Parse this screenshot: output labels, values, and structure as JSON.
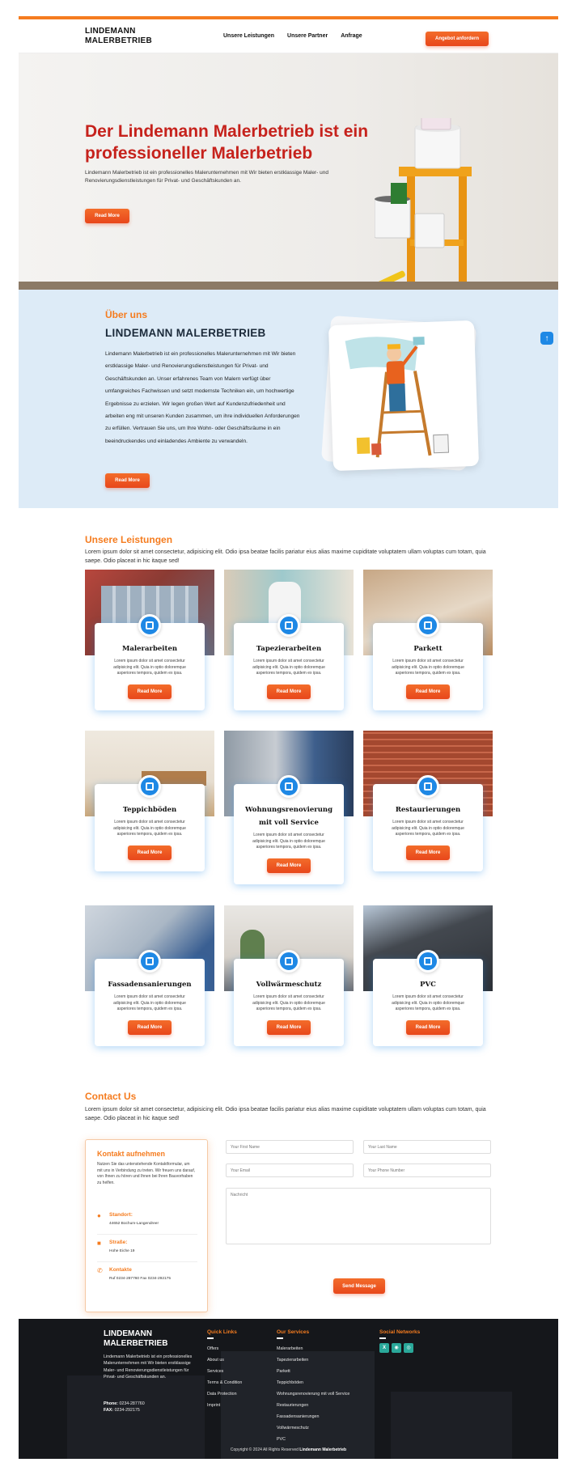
{
  "brand": {
    "logo_line1": "LINDEMANN",
    "logo_line2": "MALERBETRIEB"
  },
  "nav": {
    "links": [
      "Unsere Leistungen",
      "Unsere Partner",
      "Anfrage"
    ],
    "cta": "Angebot anfordern"
  },
  "hero": {
    "title": "Der Lindemann Malerbetrieb ist ein professioneller Malerbetrieb",
    "text": "Lindemann Malerbetrieb ist ein professionelles Malerunternehmen mit Wir bieten erstklassige Maler- und Renovierungsdienstleistungen für Privat- und Geschäftskunden an.",
    "button": "Read More"
  },
  "about": {
    "kicker": "Über uns",
    "title": "LINDEMANN MALERBETRIEB",
    "text": "Lindemann Malerbetrieb ist ein professionelles Malerunternehmen mit Wir bieten erstklassige Maler- und Renovierungsdienstleistungen für Privat- und Geschäftskunden an. Unser erfahrenes Team von Malern verfügt über umfangreiches Fachwissen und setzt modernste Techniken ein, um hochwertige Ergebnisse zu erzielen. Wir legen großen Wert auf Kundenzufriedenheit und arbeiten eng mit unseren Kunden zusammen, um ihre individuellen Anforderungen zu erfüllen. Vertrauen Sie uns, um Ihre Wohn- oder Geschäftsräume in ein beeindruckendes und einladendes Ambiente zu verwandeln.",
    "button": "Read More"
  },
  "services": {
    "title": "Unsere Leistungen",
    "text": "Lorem ipsum dolor sit amet consectetur, adipisicing elit. Odio ipsa beatae facilis pariatur eius alias maxime cupiditate voluptatem ullam voluptas cum totam, quia saepe. Odio placeat in hic itaque sed!",
    "desc": "Lorem ipsum dolor sit amet consectetur adipisicing elit. Quia in optio doloremque asperiores tempora, quidem ex ipsa.",
    "button": "Read More",
    "items": [
      "Malerarbeiten",
      "Tapezierarbeiten",
      "Parkett",
      "Teppichböden",
      "Wohnungsrenovierung mit voll Service",
      "Restaurierungen",
      "Fassadensanierungen",
      "Vollwärmeschutz",
      "PVC"
    ]
  },
  "contact": {
    "title": "Contact Us",
    "text": "Lorem ipsum dolor sit amet consectetur, adipisicing elit. Odio ipsa beatae facilis pariatur eius alias maxime cupiditate voluptatem ullam voluptas cum totam, quia saepe. Odio placeat in hic itaque sed!",
    "card_title": "Kontakt aufnehmen",
    "card_intro": "Nutzen Sie das untenstehende Kontaktformular, um mit uns in Verbindung zu treten. Wir freuen uns darauf, von Ihnen zu hören und Ihnen bei Ihren Bauvorhaben zu helfen.",
    "standort_label": "Standort:",
    "standort_value": "44652 Bochum-Langendreer",
    "strasse_label": "Straße:",
    "strasse_value": "Hohe Eiche 19",
    "kontakt_label": "Kontakte",
    "kontakt_value": "Ruf 0234-287760 Fax 0234-292175",
    "ph_first": "Your First Name",
    "ph_last": "Your Last Name",
    "ph_email": "Your Email",
    "ph_phone": "Your Phone Number",
    "ph_msg": "Nachricht",
    "send": "Send Message"
  },
  "footer": {
    "logo_line1": "LINDEMANN",
    "logo_line2": "MALERBETRIEB",
    "desc": "Lindemann Malerbetrieb ist ein professionelles Malerunternehmen mit Wir bieten erstklassige Maler- und Renovierungsdienstleistungen für Privat- und Geschäftskunden an.",
    "phone_label": "Phone:",
    "phone": "0234-287760",
    "fax_label": "FAX:",
    "fax": "0234-292175",
    "quick_title": "Quick Links",
    "quick": [
      "Offers",
      "About us",
      "Services",
      "Terms & Condition",
      "Data Protection",
      "Imprint"
    ],
    "services_title": "Our Services",
    "services": [
      "Malerarbeiten",
      "Tapezierarbeiten",
      "Parkett",
      "Teppichböden",
      "Wohnungsrenovierung mit voll Service",
      "Restaurierungen",
      "Fassadensanierungen",
      "Vollwärmeschutz",
      "PVC"
    ],
    "social_title": "Social Networks",
    "copyright": "Copyright © 2024 All Rights Reserved",
    "copyright_brand": "Lindemann Malerbetrieb"
  }
}
